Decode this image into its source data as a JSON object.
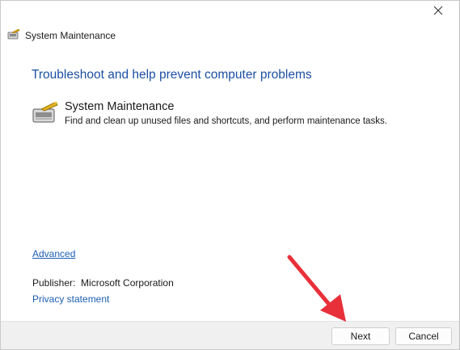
{
  "window": {
    "title": "System Maintenance"
  },
  "main": {
    "heading": "Troubleshoot and help prevent computer problems",
    "task": {
      "name": "System Maintenance",
      "description": "Find and clean up unused files and shortcuts, and perform maintenance tasks."
    },
    "advanced_link": "Advanced",
    "publisher_label": "Publisher:",
    "publisher_value": "Microsoft Corporation",
    "privacy_link": "Privacy statement"
  },
  "footer": {
    "next_label": "Next",
    "cancel_label": "Cancel"
  },
  "colors": {
    "heading": "#1c4fa3",
    "link": "#1c5fb3",
    "annotation_arrow": "#e8303a"
  },
  "icons": {
    "close": "close-icon",
    "app": "system-maintenance-icon",
    "annotation": "red-arrow-annotation"
  }
}
